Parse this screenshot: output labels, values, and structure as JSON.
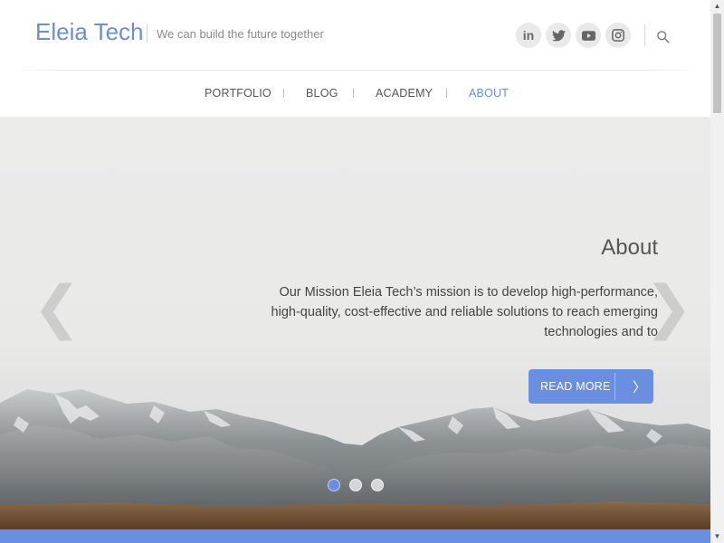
{
  "site": {
    "brand": "Eleia Tech",
    "tagline": "We can build the future together"
  },
  "social": [
    {
      "name": "linkedin-icon",
      "glyph": "in"
    },
    {
      "name": "twitter-icon"
    },
    {
      "name": "youtube-icon"
    },
    {
      "name": "instagram-icon"
    }
  ],
  "nav": {
    "items": [
      {
        "label": "PORTFOLIO",
        "active": false
      },
      {
        "label": "BLOG",
        "active": false
      },
      {
        "label": "ACADEMY",
        "active": false
      },
      {
        "label": "ABOUT",
        "active": true
      }
    ]
  },
  "hero": {
    "title": "About",
    "text": "Our Mission Eleia Tech’s mission is to develop high-performance, high-quality, cost-effective and reliable solutions to reach emerging technologies and to",
    "button_label": "READ MORE",
    "button_arrow": "〉",
    "prev_arrow": "❮",
    "next_arrow": "❯",
    "slides": 3,
    "active_slide": 1
  },
  "colors": {
    "accent": "#6b8fe0",
    "brand": "#6b8fcf"
  }
}
